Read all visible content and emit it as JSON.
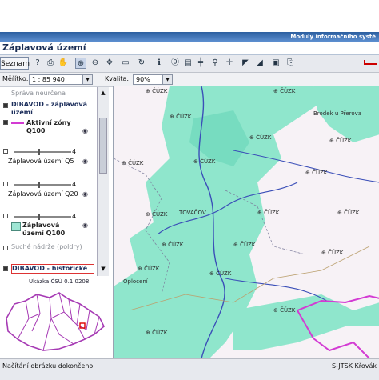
{
  "app": {
    "header_subtitle": "Moduly informačního systé",
    "window_title": "Záplavová území"
  },
  "toolbar": {
    "seznam_label": "Seznam",
    "tools": [
      {
        "name": "info-tool-icon",
        "glyph": "?"
      },
      {
        "name": "print-icon",
        "glyph": "⎙"
      },
      {
        "name": "pan-hand-icon",
        "glyph": "✋"
      },
      {
        "name": "zoom-in-icon",
        "glyph": "⊕"
      },
      {
        "name": "zoom-out-icon",
        "glyph": "⊖"
      },
      {
        "name": "move-icon",
        "glyph": "✥"
      },
      {
        "name": "full-extent-icon",
        "glyph": "▭"
      },
      {
        "name": "refresh-icon",
        "glyph": "↻"
      },
      {
        "name": "identify-icon",
        "glyph": "ℹ"
      },
      {
        "name": "layer-info-icon",
        "glyph": "⓪"
      },
      {
        "name": "legend-icon",
        "glyph": "▤"
      },
      {
        "name": "measure-icon",
        "glyph": "╪"
      },
      {
        "name": "find-binoculars-icon",
        "glyph": "⚲"
      },
      {
        "name": "add-point-icon",
        "glyph": "✛"
      },
      {
        "name": "draw-icon",
        "glyph": "◤"
      },
      {
        "name": "edit-icon",
        "glyph": "◢"
      },
      {
        "name": "save-icon",
        "glyph": "▣"
      },
      {
        "name": "export-icon",
        "glyph": "⎘"
      }
    ]
  },
  "options": {
    "scale_label": "Měřítko:",
    "scale_value": "1 : 85 940",
    "quality_label": "Kvalita:",
    "quality_value": "90%"
  },
  "layers": {
    "item0": "Správa neurčena",
    "group1": "DIBAVOD - záplavová území",
    "aktivni_zony": "Aktivní zóny Q100",
    "zaplav_q5": "Záplavová území Q5",
    "zaplav_q20": "Záplavová území Q20",
    "zaplav_q100": "Záplavová území Q100",
    "suche_nadrze": "Suché nádrže (poldry)",
    "group2": "DIBAVOD - historické",
    "slider_max": "4"
  },
  "overview": {
    "header": "Ukázka ČSÚ 0.1.0208"
  },
  "map": {
    "labels": [
      "ČÚZK",
      "ČÚZK",
      "ČÚZK",
      "ČÚZK",
      "ČÚZK",
      "ČÚZK",
      "ČÚZK",
      "ČÚZK",
      "ČÚZK",
      "ČÚZK",
      "ČÚZK",
      "ČÚZK",
      "ČÚZK",
      "ČÚZK",
      "ČÚZK",
      "ČÚZK",
      "ČÚZK",
      "ČÚZK"
    ],
    "place_brodek": "Brodek u Přerova",
    "place_tovacov": "TOVAČOV",
    "place_ob": "Oplocení"
  },
  "status": {
    "left": "Načítání obrázku dokončeno",
    "right": "S-JTSK Křovák"
  },
  "colors": {
    "flood": "#8fe6cc",
    "flood_dark": "#68d6b8",
    "river": "#3b4fb8",
    "active_zone": "#d33bd3"
  }
}
